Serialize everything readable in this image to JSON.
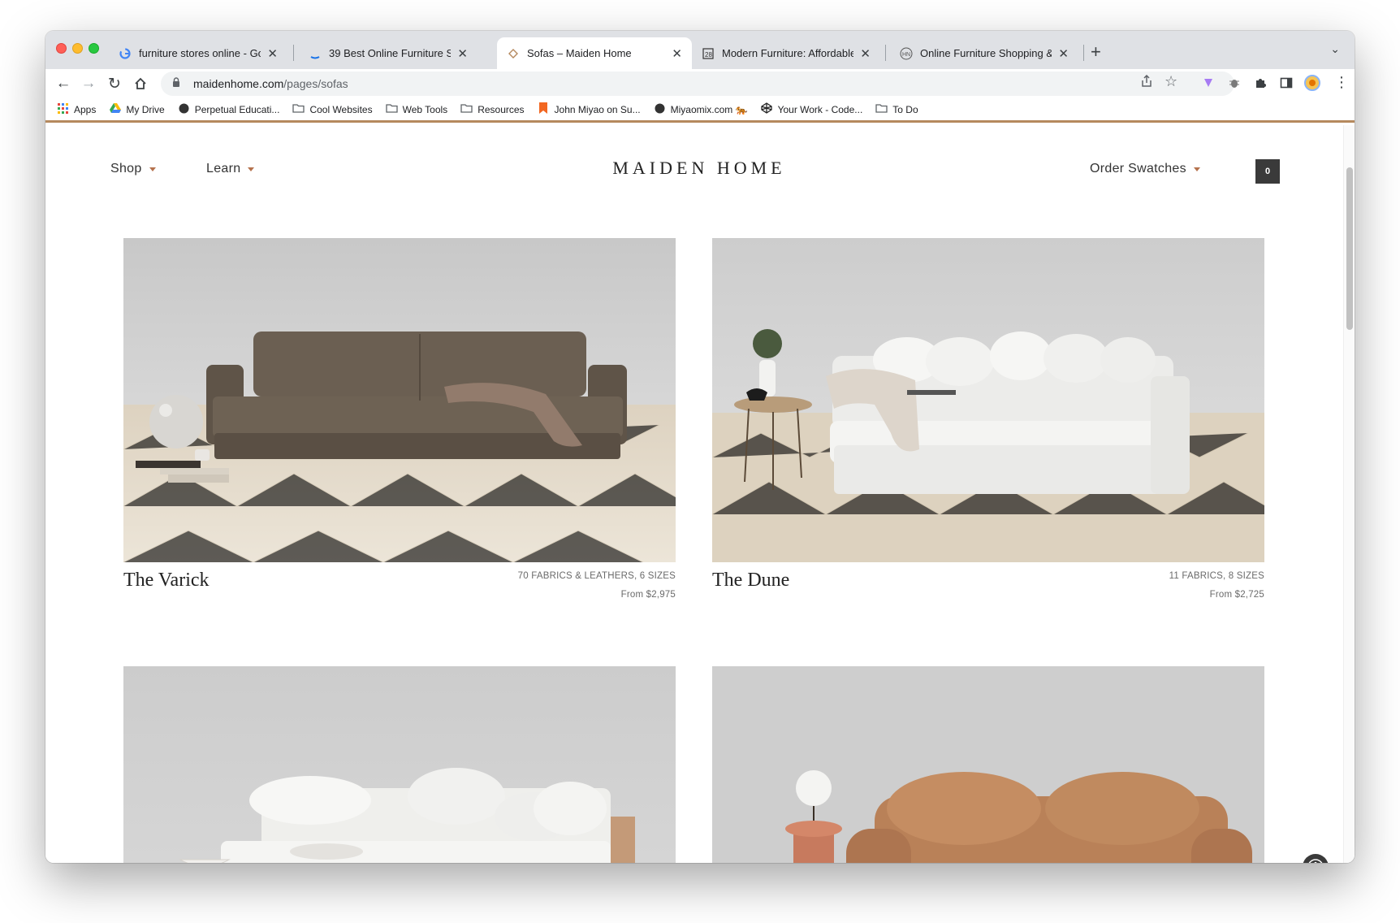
{
  "browser": {
    "tabs": [
      {
        "title": "furniture stores online - Google",
        "favicon": "google-icon",
        "active": false
      },
      {
        "title": "39 Best Online Furniture Stores",
        "favicon": "site-icon",
        "active": false
      },
      {
        "title": "Sofas – Maiden Home",
        "favicon": "maiden-home-icon",
        "active": true
      },
      {
        "title": "Modern Furniture: Affordable S",
        "favicon": "site-icon",
        "active": false
      },
      {
        "title": "Online Furniture Shopping & H",
        "favicon": "site-icon",
        "active": false
      }
    ],
    "new_tab_label": "+",
    "url_host": "maidenhome.com",
    "url_path": "/pages/sofas",
    "bookmarks": [
      {
        "label": "Apps",
        "icon": "apps-grid-icon"
      },
      {
        "label": "My Drive",
        "icon": "google-drive-icon"
      },
      {
        "label": "Perpetual Educati...",
        "icon": "circle-icon"
      },
      {
        "label": "Cool Websites",
        "icon": "folder-icon"
      },
      {
        "label": "Web Tools",
        "icon": "folder-icon"
      },
      {
        "label": "Resources",
        "icon": "folder-icon"
      },
      {
        "label": "John Miyao on Su...",
        "icon": "bookmark-flag-icon"
      },
      {
        "label": "Miyaomix.com 🐅",
        "icon": "circle-icon"
      },
      {
        "label": "Your Work - Code...",
        "icon": "codepen-icon"
      },
      {
        "label": "To Do",
        "icon": "folder-icon"
      }
    ]
  },
  "site": {
    "nav": {
      "shop": "Shop",
      "learn": "Learn",
      "logo": "MAIDEN HOME",
      "order_swatches": "Order Swatches",
      "cart_count": "0"
    },
    "products": [
      {
        "name": "The Varick",
        "options": "70 FABRICS & LEATHERS, 6 SIZES",
        "price": "From $2,975"
      },
      {
        "name": "The Dune",
        "options": "11 FABRICS, 8 SIZES",
        "price": "From $2,725"
      },
      {
        "name": "",
        "options": "",
        "price": ""
      },
      {
        "name": "",
        "options": "",
        "price": ""
      }
    ]
  },
  "colors": {
    "accent_caret": "#b5724d",
    "bookmark_rule": "#b5895e",
    "cart_bg": "#3a3a3a"
  }
}
